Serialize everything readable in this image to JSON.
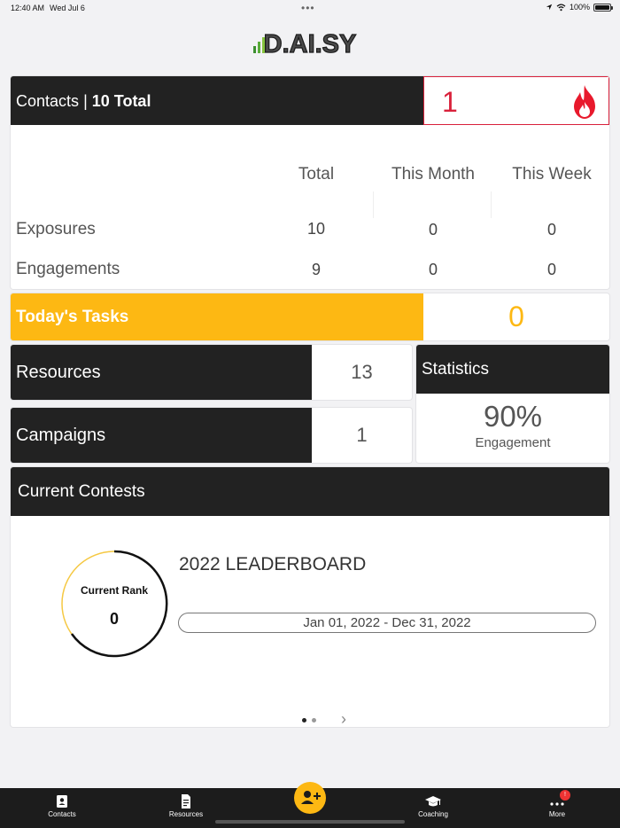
{
  "status_bar": {
    "time": "12:40 AM",
    "date": "Wed Jul 6",
    "battery": "100%"
  },
  "app": {
    "logo_text": "D.AI.SY"
  },
  "contacts": {
    "title": "Contacts",
    "separator": "|",
    "total_text": "10 Total",
    "hot_count": "1",
    "columns": [
      "Total",
      "This Month",
      "This Week"
    ],
    "rows": [
      {
        "label": "Exposures",
        "values": [
          "10",
          "0",
          "0"
        ]
      },
      {
        "label": "Engagements",
        "values": [
          "9",
          "0",
          "0"
        ]
      }
    ]
  },
  "tasks": {
    "label": "Today's Tasks",
    "count": "0"
  },
  "resources": {
    "label": "Resources",
    "count": "13"
  },
  "campaigns": {
    "label": "Campaigns",
    "count": "1"
  },
  "statistics": {
    "label": "Statistics",
    "value": "90%",
    "value_label": "Engagement"
  },
  "contests": {
    "title": "Current Contests",
    "rank_label": "Current Rank",
    "rank_value": "0",
    "contest_name": "2022 LEADERBOARD",
    "date_range": "Jan 01, 2022 - Dec 31, 2022"
  },
  "tab_bar": {
    "items": [
      {
        "label": "Contacts",
        "icon": "contacts-icon"
      },
      {
        "label": "Resources",
        "icon": "document-icon"
      },
      {
        "label": "",
        "icon": "add-contact-icon"
      },
      {
        "label": "Coaching",
        "icon": "graduation-cap-icon"
      },
      {
        "label": "More",
        "icon": "more-icon",
        "badge": "!"
      }
    ]
  },
  "colors": {
    "accent": "#fdb813",
    "hot": "#d9213b",
    "dark": "#222222"
  }
}
